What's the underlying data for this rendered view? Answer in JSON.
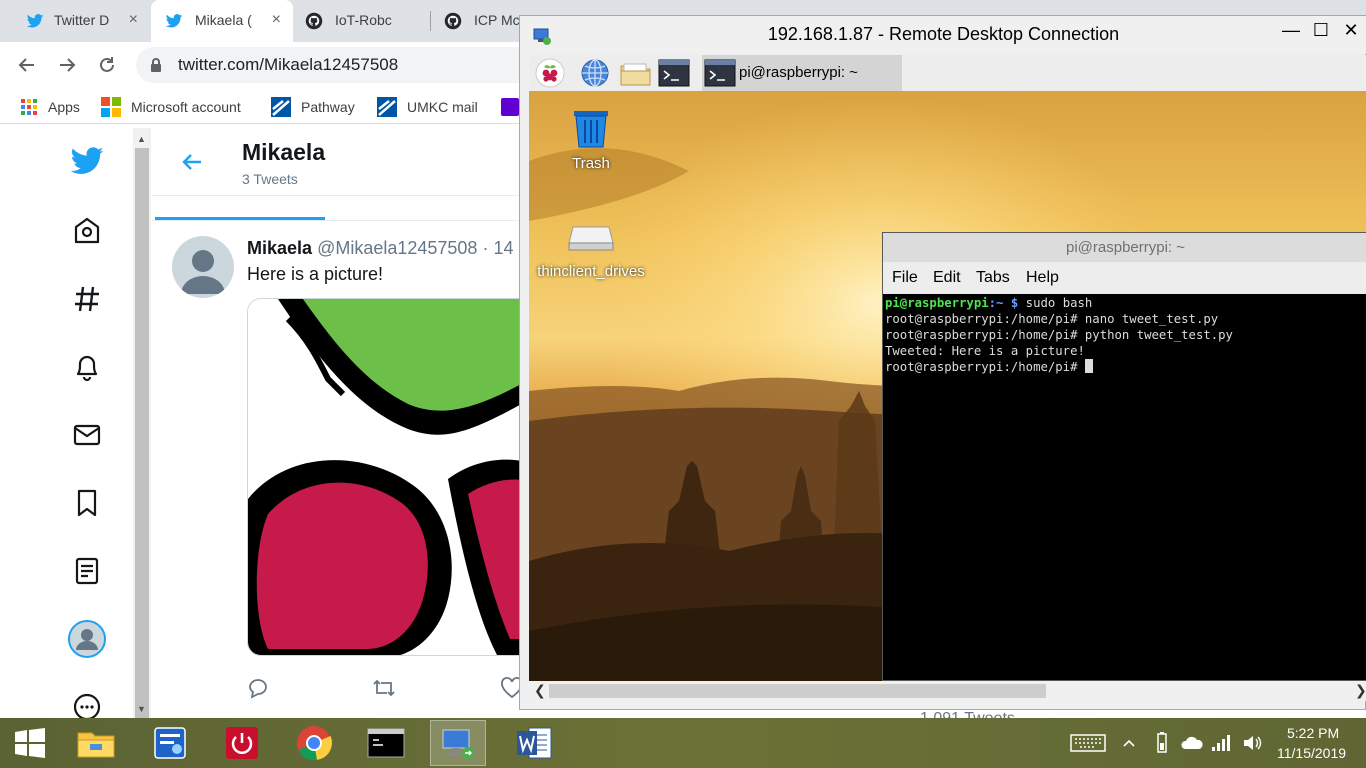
{
  "browser": {
    "tabs": [
      {
        "label": "Twitter D",
        "icon": "twitter-icon"
      },
      {
        "label": "Mikaela (",
        "icon": "twitter-icon",
        "active": true
      },
      {
        "label": "IoT-Robc",
        "icon": "github-icon"
      },
      {
        "label": "ICP Mc",
        "icon": "github-icon"
      }
    ],
    "tab_close": "×",
    "url": "twitter.com/Mikaela12457508",
    "bookmarks": [
      {
        "label": "Apps",
        "icon": "apps-grid-icon"
      },
      {
        "label": "Microsoft account",
        "icon": "microsoft-icon"
      },
      {
        "label": "Pathway",
        "icon": "pathway-icon"
      },
      {
        "label": "UMKC mail",
        "icon": "umkc-icon"
      }
    ]
  },
  "twitter": {
    "profile_name": "Mikaela",
    "tweet_count": "3 Tweets",
    "tweet": {
      "author_name": "Mikaela",
      "handle": "@Mikaela12457508 · 14",
      "text": "Here is a picture!"
    },
    "nav_icons": [
      "twitter-logo-icon",
      "home-icon",
      "explore-hashtag-icon",
      "notifications-bell-icon",
      "messages-envelope-icon",
      "bookmarks-icon",
      "lists-icon",
      "profile-icon",
      "more-icon"
    ],
    "accent_color": "#1da1f2",
    "background_tweets": "1,091 Tweets"
  },
  "rdp": {
    "title": "192.168.1.87 - Remote Desktop Connection",
    "controls": {
      "minimize": "—",
      "maximize": "☐",
      "close": "✕"
    },
    "panel_task_label": "pi@raspberrypi: ~",
    "desktop_icons": [
      {
        "label": "Trash",
        "icon": "trash-icon"
      },
      {
        "label": "thinclient_drives",
        "icon": "drive-icon"
      }
    ],
    "terminal": {
      "title": "pi@raspberrypi: ~",
      "menu": [
        "File",
        "Edit",
        "Tabs",
        "Help"
      ],
      "first_prompt_user": "pi@raspberrypi",
      "first_prompt_path": ":~ $",
      "first_command": " sudo bash",
      "lines": [
        "root@raspberrypi:/home/pi# nano tweet_test.py",
        "root@raspberrypi:/home/pi# python tweet_test.py",
        "Tweeted: Here is a picture!",
        "root@raspberrypi:/home/pi# "
      ]
    }
  },
  "taskbar": {
    "apps": [
      "file-explorer-icon",
      "control-panel-icon",
      "shutdown-icon",
      "chrome-icon",
      "command-prompt-icon",
      "remote-desktop-icon",
      "word-icon"
    ],
    "time": "5:22 PM",
    "date": "11/15/2019"
  }
}
